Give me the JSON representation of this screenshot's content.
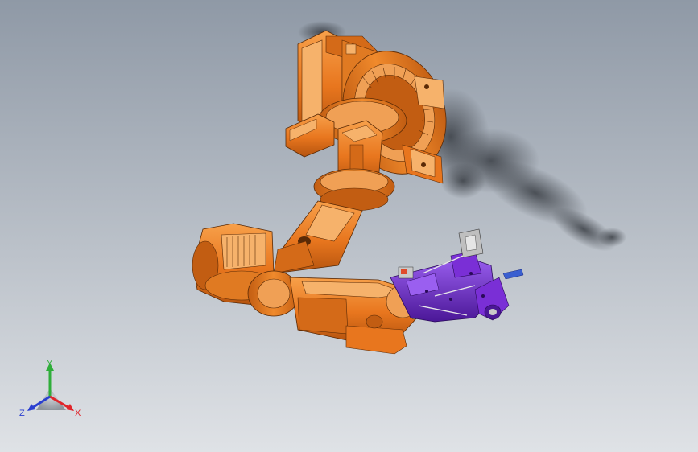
{
  "viewport": {
    "background_top": "#8f99a6",
    "background_bottom": "#dfe2e6"
  },
  "model": {
    "robot_color": "#e8761e",
    "robot_highlight": "#f6b26b",
    "robot_shade": "#b4530e",
    "gripper_color": "#7a2fd6",
    "gripper_shade": "#4b1797",
    "shadow_color": "#3a3f45"
  },
  "triad": {
    "x_label": "X",
    "y_label": "Y",
    "z_label": "Z",
    "x_color": "#e0262b",
    "y_color": "#2fae3a",
    "z_color": "#2a3fd0"
  }
}
